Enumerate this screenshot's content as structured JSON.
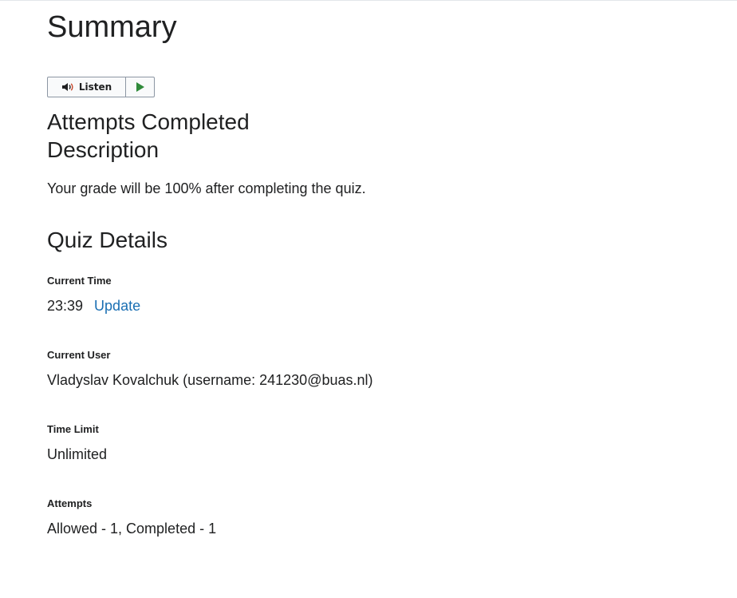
{
  "page": {
    "title": "Summary"
  },
  "listen": {
    "label": "Listen",
    "speaker_icon": "speaker-icon",
    "play_icon": "play-icon",
    "play_color": "#2f8a3a"
  },
  "summary": {
    "attempts_heading": "Attempts Completed",
    "description_heading": "Description",
    "description_text": "Your grade will be 100% after completing the quiz."
  },
  "quiz_details": {
    "heading": "Quiz Details",
    "current_time": {
      "label": "Current Time",
      "value": "23:39",
      "update_label": "Update"
    },
    "current_user": {
      "label": "Current User",
      "value": "Vladyslav Kovalchuk (username: 241230@buas.nl)"
    },
    "time_limit": {
      "label": "Time Limit",
      "value": "Unlimited"
    },
    "attempts": {
      "label": "Attempts",
      "value": "Allowed - 1, Completed - 1"
    }
  },
  "colors": {
    "text": "#202122",
    "link": "#1a6fb3",
    "border": "#8c96a3"
  }
}
